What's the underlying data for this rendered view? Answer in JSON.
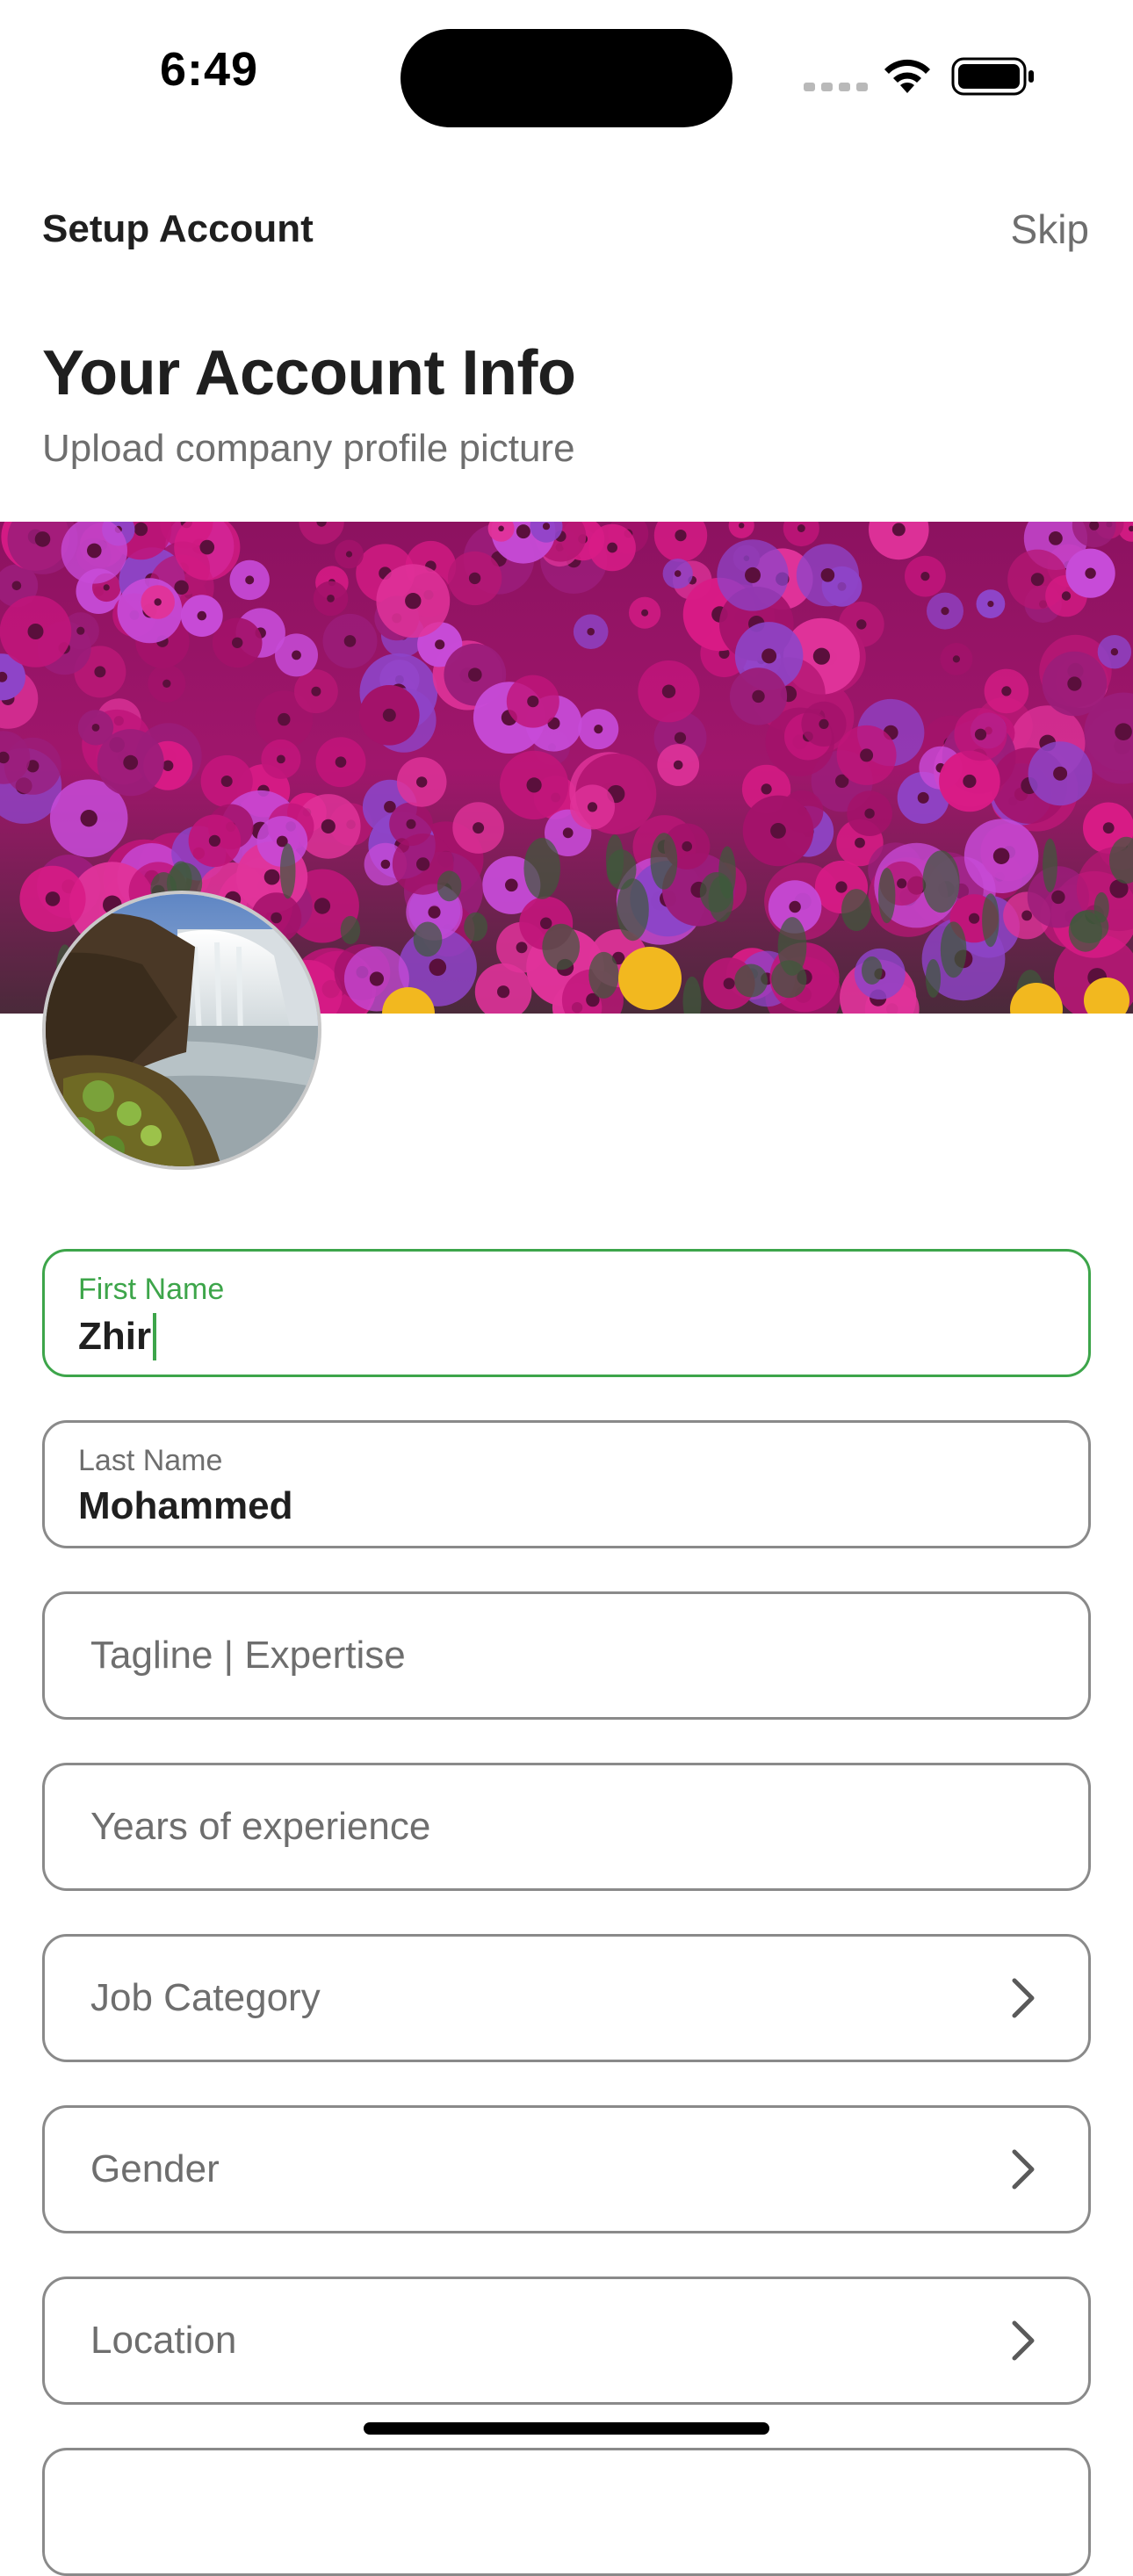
{
  "status_bar": {
    "time": "6:49"
  },
  "nav": {
    "title": "Setup Account",
    "skip_label": "Skip"
  },
  "header": {
    "title": "Your Account Info",
    "subtitle": "Upload company profile picture"
  },
  "images": {
    "cover": "flower-field-photo",
    "avatar": "waterfall-photo"
  },
  "form": {
    "first_name": {
      "label": "First Name",
      "value": "Zhir"
    },
    "last_name": {
      "label": "Last Name",
      "value": "Mohammed"
    },
    "tagline": {
      "placeholder": "Tagline | Expertise"
    },
    "experience": {
      "placeholder": "Years of experience"
    },
    "job_category": {
      "placeholder": "Job Category"
    },
    "gender": {
      "placeholder": "Gender"
    },
    "location": {
      "placeholder": "Location"
    }
  },
  "colors": {
    "accent": "#3da54a",
    "field_border": "#8a8a8a",
    "text_primary": "#1f1f1f",
    "text_secondary": "#6e6e6e"
  }
}
